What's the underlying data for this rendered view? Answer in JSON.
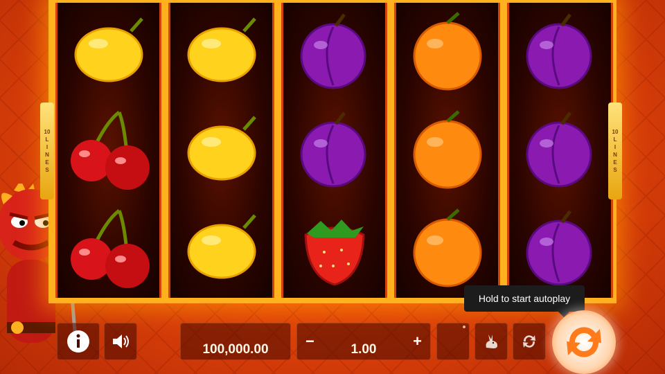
{
  "reels": [
    {
      "lines_label": [
        "10",
        "L",
        "I",
        "N",
        "E",
        "S"
      ],
      "symbols": [
        "lemon-icon",
        "cherry-icon",
        "cherry-icon"
      ]
    },
    {
      "symbols": [
        "lemon-icon",
        "lemon-icon",
        "lemon-icon"
      ]
    },
    {
      "symbols": [
        "plum-icon",
        "plum-icon",
        "strawberry-icon"
      ]
    },
    {
      "symbols": [
        "orange-icon",
        "orange-icon",
        "orange-icon"
      ]
    },
    {
      "symbols": [
        "plum-icon",
        "plum-icon",
        "plum-icon"
      ]
    }
  ],
  "lines_left": {
    "count": "10",
    "word": [
      "L",
      "I",
      "N",
      "E",
      "S"
    ]
  },
  "lines_right": {
    "count": "10",
    "word": [
      "L",
      "I",
      "N",
      "E",
      "S"
    ]
  },
  "balance": "100,000.00",
  "bet": {
    "value": "1.00",
    "minus": "−",
    "plus": "+"
  },
  "tooltip": "Hold to start autoplay",
  "colors": {
    "accent": "#ff7a1a",
    "frame": "#ffb21e",
    "panel": "#46080080"
  }
}
